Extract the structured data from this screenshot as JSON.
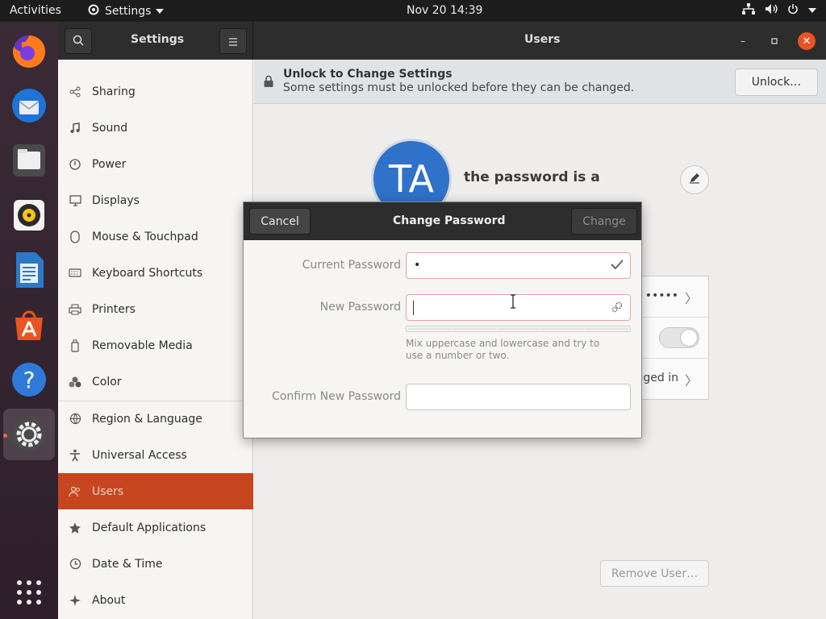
{
  "topbar": {
    "activities": "Activities",
    "app_menu": "Settings",
    "clock": "Nov 20  14:39"
  },
  "dock": {
    "items": [
      "firefox-icon",
      "thunderbird-icon",
      "files-icon",
      "rhythmbox-icon",
      "libreoffice-writer-icon",
      "app-center-icon",
      "help-icon",
      "settings-icon",
      "show-applications-icon"
    ]
  },
  "window": {
    "sidebar_title": "Settings",
    "main_title": "Users"
  },
  "sidebar": {
    "items": [
      {
        "label": "Sharing",
        "icon": "share-icon"
      },
      {
        "label": "Sound",
        "icon": "music-note-icon"
      },
      {
        "label": "Power",
        "icon": "power-icon"
      },
      {
        "label": "Displays",
        "icon": "display-icon"
      },
      {
        "label": "Mouse & Touchpad",
        "icon": "mouse-icon"
      },
      {
        "label": "Keyboard Shortcuts",
        "icon": "keyboard-icon"
      },
      {
        "label": "Printers",
        "icon": "printer-icon"
      },
      {
        "label": "Removable Media",
        "icon": "removable-media-icon"
      },
      {
        "label": "Color",
        "icon": "color-icon"
      },
      {
        "label": "Region & Language",
        "icon": "globe-icon"
      },
      {
        "label": "Universal Access",
        "icon": "accessibility-icon"
      },
      {
        "label": "Users",
        "icon": "users-icon",
        "selected": true
      },
      {
        "label": "Default Applications",
        "icon": "star-icon"
      },
      {
        "label": "Date & Time",
        "icon": "clock-icon"
      },
      {
        "label": "About",
        "icon": "about-icon"
      }
    ]
  },
  "infobar": {
    "title": "Unlock to Change Settings",
    "description": "Some settings must be unlocked before they can be changed.",
    "unlock_label": "Unlock…"
  },
  "user": {
    "initials": "TA",
    "full_name": "the password is a",
    "password_value": "•••••",
    "logged_in_label": "gged in",
    "remove_label": "Remove User…"
  },
  "dialog": {
    "title": "Change Password",
    "cancel_label": "Cancel",
    "change_label": "Change",
    "current_password_label": "Current Password",
    "current_password_value": "•",
    "new_password_label": "New Password",
    "new_password_value": "",
    "hint": "Mix uppercase and lowercase and try to use a number or two.",
    "confirm_password_label": "Confirm New Password",
    "confirm_password_value": ""
  },
  "colors": {
    "accent": "#e95420",
    "selected_row": "#c7461f",
    "avatar": "#3071c9"
  }
}
